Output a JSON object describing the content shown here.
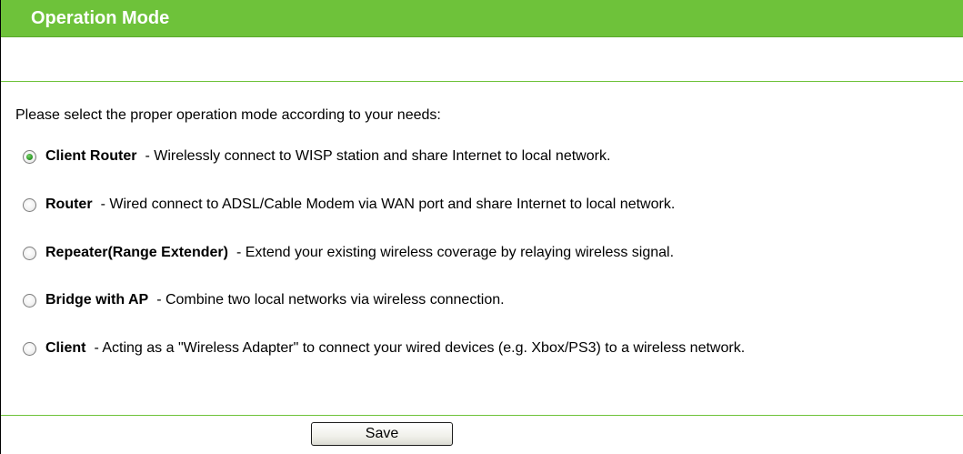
{
  "header": {
    "title": "Operation Mode"
  },
  "intro_text": "Please select the proper operation mode according to your needs:",
  "options": [
    {
      "name": "Client Router",
      "description": "- Wirelessly connect to WISP station and share Internet to local network.",
      "selected": true
    },
    {
      "name": "Router",
      "description": "- Wired connect to ADSL/Cable Modem via WAN port and share Internet to local network.",
      "selected": false
    },
    {
      "name": "Repeater(Range Extender)",
      "description": "- Extend your existing wireless coverage by relaying wireless signal.",
      "selected": false
    },
    {
      "name": "Bridge with AP",
      "description": "- Combine two local networks via wireless connection.",
      "selected": false
    },
    {
      "name": "Client",
      "description": "- Acting as a \"Wireless Adapter\" to connect your wired devices (e.g. Xbox/PS3) to a wireless network.",
      "selected": false
    }
  ],
  "save_button": {
    "label": "Save"
  },
  "colors": {
    "title_bar": "#6ec23a",
    "title_text": "#ffffff",
    "divider": "#6ec23a",
    "radio_selected_dot": "#2f9a2a"
  },
  "icons": {
    "radio_selected": "radio-selected-icon",
    "radio_unselected": "radio-unselected-icon"
  }
}
